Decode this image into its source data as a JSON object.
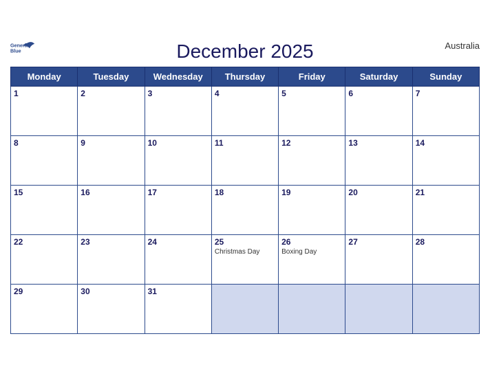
{
  "calendar": {
    "month": "December 2025",
    "country": "Australia",
    "logo": {
      "line1": "General",
      "line2": "Blue"
    },
    "days_of_week": [
      "Monday",
      "Tuesday",
      "Wednesday",
      "Thursday",
      "Friday",
      "Saturday",
      "Sunday"
    ],
    "weeks": [
      [
        {
          "day": "1",
          "holiday": "",
          "empty": false
        },
        {
          "day": "2",
          "holiday": "",
          "empty": false
        },
        {
          "day": "3",
          "holiday": "",
          "empty": false
        },
        {
          "day": "4",
          "holiday": "",
          "empty": false
        },
        {
          "day": "5",
          "holiday": "",
          "empty": false
        },
        {
          "day": "6",
          "holiday": "",
          "empty": false
        },
        {
          "day": "7",
          "holiday": "",
          "empty": false
        }
      ],
      [
        {
          "day": "8",
          "holiday": "",
          "empty": false
        },
        {
          "day": "9",
          "holiday": "",
          "empty": false
        },
        {
          "day": "10",
          "holiday": "",
          "empty": false
        },
        {
          "day": "11",
          "holiday": "",
          "empty": false
        },
        {
          "day": "12",
          "holiday": "",
          "empty": false
        },
        {
          "day": "13",
          "holiday": "",
          "empty": false
        },
        {
          "day": "14",
          "holiday": "",
          "empty": false
        }
      ],
      [
        {
          "day": "15",
          "holiday": "",
          "empty": false
        },
        {
          "day": "16",
          "holiday": "",
          "empty": false
        },
        {
          "day": "17",
          "holiday": "",
          "empty": false
        },
        {
          "day": "18",
          "holiday": "",
          "empty": false
        },
        {
          "day": "19",
          "holiday": "",
          "empty": false
        },
        {
          "day": "20",
          "holiday": "",
          "empty": false
        },
        {
          "day": "21",
          "holiday": "",
          "empty": false
        }
      ],
      [
        {
          "day": "22",
          "holiday": "",
          "empty": false
        },
        {
          "day": "23",
          "holiday": "",
          "empty": false
        },
        {
          "day": "24",
          "holiday": "",
          "empty": false
        },
        {
          "day": "25",
          "holiday": "Christmas Day",
          "empty": false
        },
        {
          "day": "26",
          "holiday": "Boxing Day",
          "empty": false
        },
        {
          "day": "27",
          "holiday": "",
          "empty": false
        },
        {
          "day": "28",
          "holiday": "",
          "empty": false
        }
      ],
      [
        {
          "day": "29",
          "holiday": "",
          "empty": false
        },
        {
          "day": "30",
          "holiday": "",
          "empty": false
        },
        {
          "day": "31",
          "holiday": "",
          "empty": false
        },
        {
          "day": "",
          "holiday": "",
          "empty": true
        },
        {
          "day": "",
          "holiday": "",
          "empty": true
        },
        {
          "day": "",
          "holiday": "",
          "empty": true
        },
        {
          "day": "",
          "holiday": "",
          "empty": true
        }
      ]
    ]
  }
}
